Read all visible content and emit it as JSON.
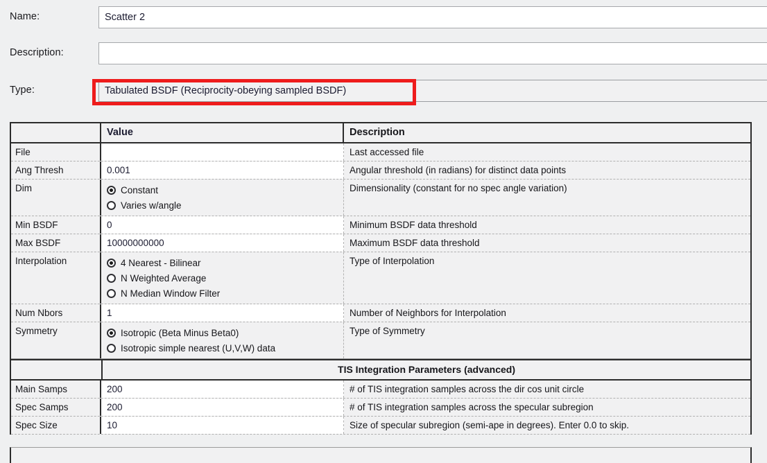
{
  "form": {
    "rows": [
      {
        "label": "Name:",
        "value": "Scatter 2",
        "kind": "text"
      },
      {
        "label": "Description:",
        "value": "",
        "kind": "text"
      },
      {
        "label": "Type:",
        "value": "Tabulated BSDF (Reciprocity-obeying sampled BSDF)",
        "kind": "combo"
      }
    ]
  },
  "highlight": {
    "color": "#ee1c1c",
    "target": "type-combo"
  },
  "table": {
    "headers": {
      "name": "",
      "value": "Value",
      "description": "Description"
    },
    "rows": [
      {
        "name": "File",
        "value": "",
        "description": "Last accessed file",
        "value_bg": "white"
      },
      {
        "name": "Ang Thresh",
        "value": "0.001",
        "description": "Angular threshold (in radians) for distinct data points",
        "value_bg": "white"
      },
      {
        "name": "Dim",
        "description": "Dimensionality (constant for no spec angle variation)",
        "radios": [
          {
            "label": "Constant",
            "selected": true
          },
          {
            "label": "Varies w/angle",
            "selected": false
          }
        ]
      },
      {
        "name": "Min BSDF",
        "value": "0",
        "description": "Minimum BSDF data threshold",
        "value_bg": "white"
      },
      {
        "name": "Max BSDF",
        "value": "10000000000",
        "description": "Maximum BSDF data threshold",
        "value_bg": "white"
      },
      {
        "name": "Interpolation",
        "description": "Type of Interpolation",
        "radios": [
          {
            "label": "4 Nearest - Bilinear",
            "selected": true
          },
          {
            "label": "N Weighted Average",
            "selected": false
          },
          {
            "label": "N Median Window Filter",
            "selected": false
          }
        ]
      },
      {
        "name": "Num Nbors",
        "value": "1",
        "description": "Number of Neighbors for Interpolation",
        "value_bg": "white"
      },
      {
        "name": "Symmetry",
        "description": "Type of Symmetry",
        "radios": [
          {
            "label": "Isotropic (Beta Minus Beta0)",
            "selected": true
          },
          {
            "label": "Isotropic simple nearest (U,V,W) data",
            "selected": false
          }
        ]
      }
    ],
    "section": {
      "title": "TIS Integration Parameters (advanced)"
    },
    "section_rows": [
      {
        "name": "Main Samps",
        "value": "200",
        "description": "# of TIS integration samples across the dir cos unit circle",
        "value_bg": "white"
      },
      {
        "name": "Spec Samps",
        "value": "200",
        "description": "# of TIS integration samples across the specular subregion",
        "value_bg": "white"
      },
      {
        "name": "Spec Size",
        "value": "10",
        "description": "Size of specular subregion (semi-ape in degrees).  Enter 0.0 to skip.",
        "value_bg": "white"
      }
    ]
  }
}
